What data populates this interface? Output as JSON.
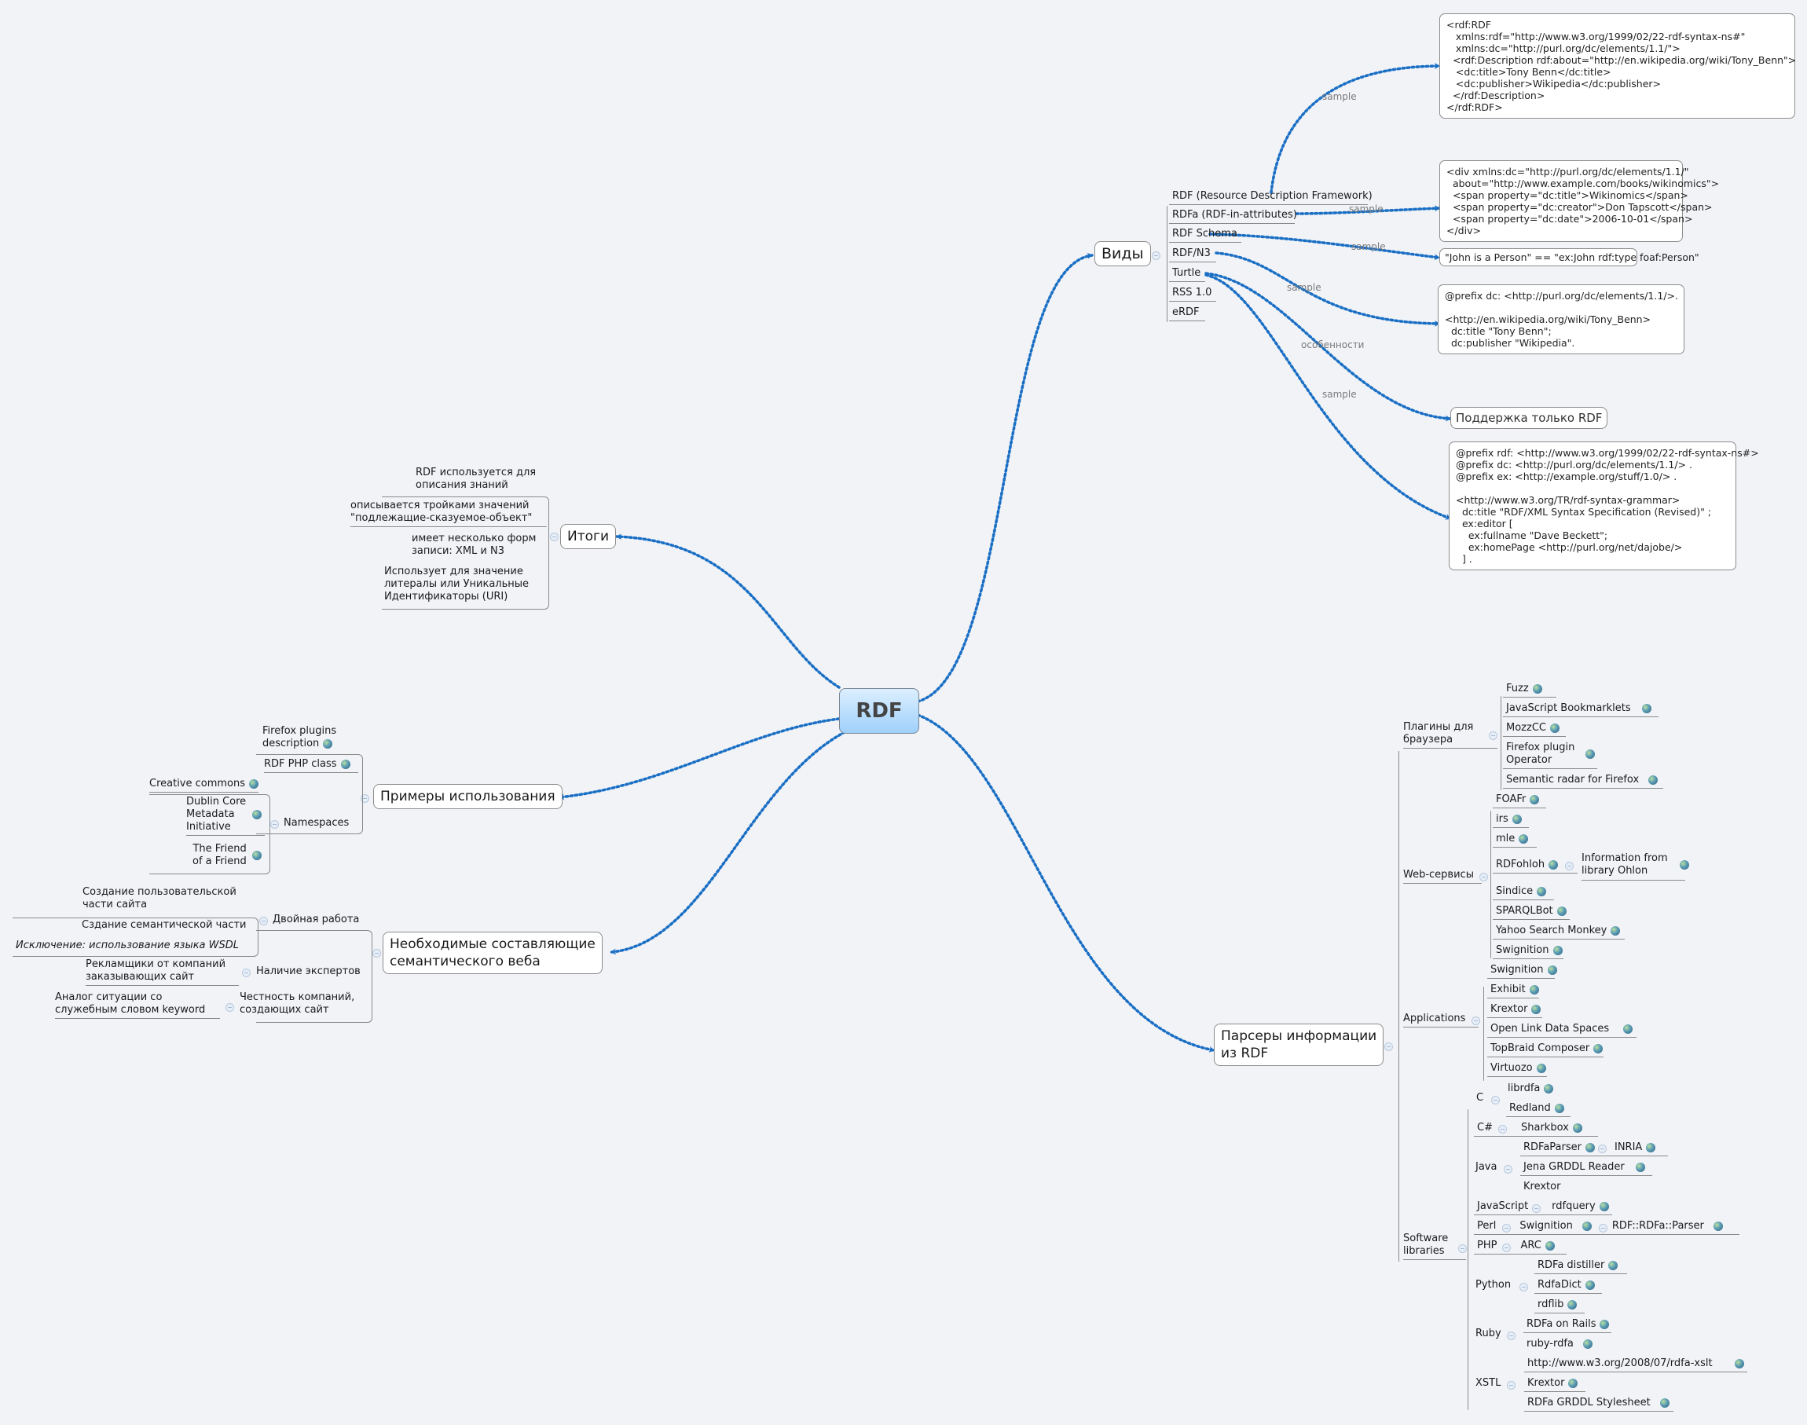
{
  "central": {
    "label": "RDF"
  },
  "colors": {
    "link": "#1a6fc4",
    "central_top": "#dcefff",
    "central_bottom": "#9fd0fb",
    "background": "#f1f3f7"
  },
  "vidy": {
    "label": "Виды",
    "items": [
      "RDF (Resource Description Framework)",
      "RDFa (RDF-in-attributes)",
      "RDF Schema",
      "RDF/N3",
      "Turtle",
      "RSS 1.0",
      "eRDF"
    ]
  },
  "samples": {
    "rdfxml": "<rdf:RDF\n   xmlns:rdf=\"http://www.w3.org/1999/02/22-rdf-syntax-ns#\"\n   xmlns:dc=\"http://purl.org/dc/elements/1.1/\">\n  <rdf:Description rdf:about=\"http://en.wikipedia.org/wiki/Tony_Benn\">\n   <dc:title>Tony Benn</dc:title>\n   <dc:publisher>Wikipedia</dc:publisher>\n  </rdf:Description>\n</rdf:RDF>",
    "rdfa": "<div xmlns:dc=\"http://purl.org/dc/elements/1.1/\"\n  about=\"http://www.example.com/books/wikinomics\">\n  <span property=\"dc:title\">Wikinomics</span>\n  <span property=\"dc:creator\">Don Tapscott</span>\n  <span property=\"dc:date\">2006-10-01</span>\n</div>",
    "schema": "\"John is a Person\" == \"ex:John rdf:type foaf:Person\"",
    "n3": "@prefix dc: <http://purl.org/dc/elements/1.1/>.\n\n<http://en.wikipedia.org/wiki/Tony_Benn>\n  dc:title \"Tony Benn\";\n  dc:publisher \"Wikipedia\".",
    "turtle_feature": "Поддержка только RDF",
    "turtle": "@prefix rdf: <http://www.w3.org/1999/02/22-rdf-syntax-ns#>\n@prefix dc: <http://purl.org/dc/elements/1.1/> .\n@prefix ex: <http://example.org/stuff/1.0/> .\n\n<http://www.w3.org/TR/rdf-syntax-grammar>\n  dc:title \"RDF/XML Syntax Specification (Revised)\" ;\n  ex:editor [\n    ex:fullname \"Dave Beckett\";\n    ex:homePage <http://purl.org/net/dajobe/>\n  ] ."
  },
  "edge_labels": {
    "sample": "sample",
    "feature": "особенности"
  },
  "itogi": {
    "label": "Итоги",
    "items": [
      "RDF используется для\nописания знаний",
      "описывается тройками значений\n\"подлежащие-сказуемое-объект\"",
      "имеет несколько форм\nзаписи: XML и N3",
      "Использует для значение\nлитералы или Уникальные\nИдентификаторы (URI)"
    ]
  },
  "primery": {
    "label": "Примеры использования",
    "items": [
      "Firefox plugins\ndescription",
      "RDF PHP class"
    ],
    "namespaces": {
      "label": "Namespaces",
      "items": [
        "Creative commons",
        "Dublin Core\nMetadata\nInitiative",
        "The Friend\nof a Friend"
      ]
    }
  },
  "neobh": {
    "label": "Необходимые составляющие\nсемантического веба",
    "groups": [
      {
        "label": "Двойная работа",
        "items": [
          "Создание пользовательской\nчасти сайта",
          "Сздание семантической части",
          "Исключение: использование языка WSDL"
        ]
      },
      {
        "label": "Наличие экспертов",
        "items": [
          "Рекламщики от компаний\nзаказывающих сайт"
        ]
      },
      {
        "label": "Честность компаний,\nсоздающих сайт",
        "items": [
          "Аналог ситуации со\nслужебным словом keyword"
        ]
      }
    ]
  },
  "parsers": {
    "label": "Парсеры информации\nиз RDF",
    "plugins": {
      "label": "Плагины для\nбраузера",
      "items": [
        "Fuzz",
        "JavaScript Bookmarklets",
        "MozzCC",
        "Firefox plugin\nOperator",
        "Semantic radar for Firefox"
      ]
    },
    "web": {
      "label": "Web-сервисы",
      "items": [
        "FOAFr",
        "irs",
        "mle",
        "RDFohloh",
        "Sindice",
        "SPARQLBot",
        "Yahoo Search Monkey",
        "Swignition"
      ],
      "rdfohloh_child": "Information from\nlibrary Ohlon"
    },
    "apps": {
      "label": "Applications",
      "items": [
        "Swignition",
        "Exhibit",
        "Krextor",
        "Open Link Data Spaces",
        "TopBraid Composer",
        "Virtuozo"
      ]
    },
    "libs": {
      "label": "Software\nlibraries",
      "langs": [
        {
          "lang": "C",
          "items": [
            "librdfa",
            "Redland"
          ]
        },
        {
          "lang": "C#",
          "items": [
            "Sharkbox"
          ]
        },
        {
          "lang": "Java",
          "items": [
            "RDFaParser",
            "Jena GRDDL Reader",
            "Krextor"
          ],
          "sub": "INRIA"
        },
        {
          "lang": "JavaScript",
          "items": [
            "rdfquery"
          ]
        },
        {
          "lang": "Perl",
          "items": [
            "Swignition"
          ],
          "sub": "RDF::RDFa::Parser"
        },
        {
          "lang": "PHP",
          "items": [
            "ARC"
          ]
        },
        {
          "lang": "Python",
          "items": [
            "RDFa distiller",
            "RdfaDict",
            "rdflib"
          ]
        },
        {
          "lang": "Ruby",
          "items": [
            "RDFa on Rails",
            "ruby-rdfa"
          ]
        },
        {
          "lang": "XSTL",
          "items": [
            "http://www.w3.org/2008/07/rdfa-xslt",
            "Krextor",
            "RDFa GRDDL Stylesheet"
          ]
        }
      ]
    }
  }
}
